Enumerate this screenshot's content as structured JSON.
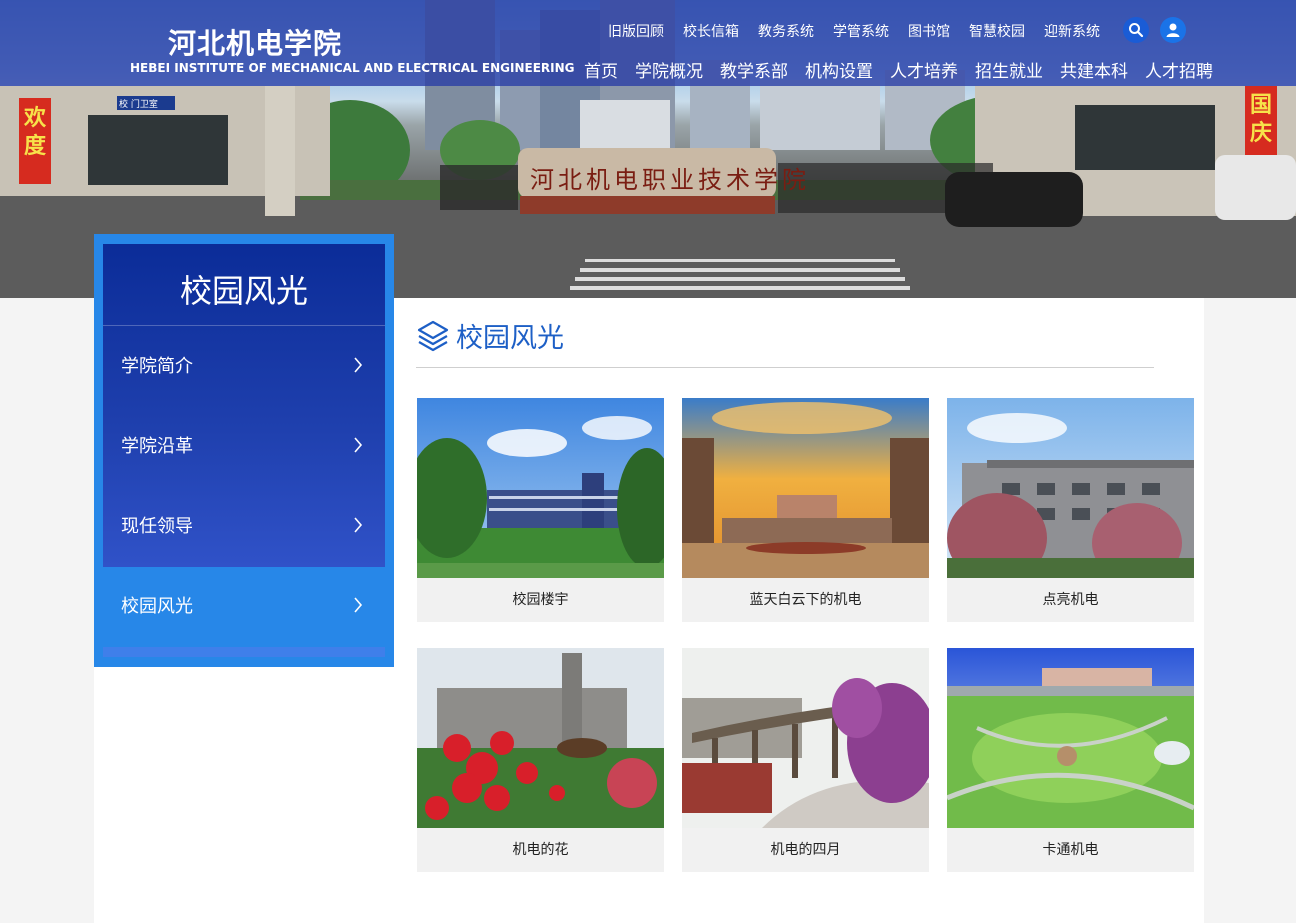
{
  "header": {
    "logo_cn": "河北机电学院",
    "logo_en": "HEBEI INSTITUTE OF MECHANICAL AND ELECTRICAL ENGINEERING",
    "top_links": [
      "旧版回顾",
      "校长信箱",
      "教务系统",
      "学管系统",
      "图书馆",
      "智慧校园",
      "迎新系统"
    ],
    "main_nav": [
      "首页",
      "学院概况",
      "教学系部",
      "机构设置",
      "人才培养",
      "招生就业",
      "共建本科",
      "人才招聘"
    ],
    "search_icon": "search-icon",
    "user_icon": "user-icon"
  },
  "banner": {
    "left_banner": "欢度",
    "right_banner": "国庆",
    "gate_sign": "校 门卫室",
    "stone_inscription": "河北机电职业技术学院"
  },
  "sidebar": {
    "title": "校园风光",
    "items": [
      {
        "label": "学院简介"
      },
      {
        "label": "学院沿革"
      },
      {
        "label": "现任领导"
      },
      {
        "label": "校园风光",
        "active": true
      }
    ]
  },
  "main": {
    "section_title": "校园风光",
    "section_icon": "layers-icon",
    "gallery": [
      {
        "caption": "校园楼宇"
      },
      {
        "caption": "蓝天白云下的机电"
      },
      {
        "caption": "点亮机电"
      },
      {
        "caption": "机电的花"
      },
      {
        "caption": "机电的四月"
      },
      {
        "caption": "卡通机电"
      }
    ]
  },
  "colors": {
    "header_bg": "#2c3ea6",
    "sidebar_bg": "#2787e8",
    "sidebar_panel": "#0b2c98",
    "accent_text": "#1d5fc6",
    "caption_bg": "#f1f1f1"
  }
}
